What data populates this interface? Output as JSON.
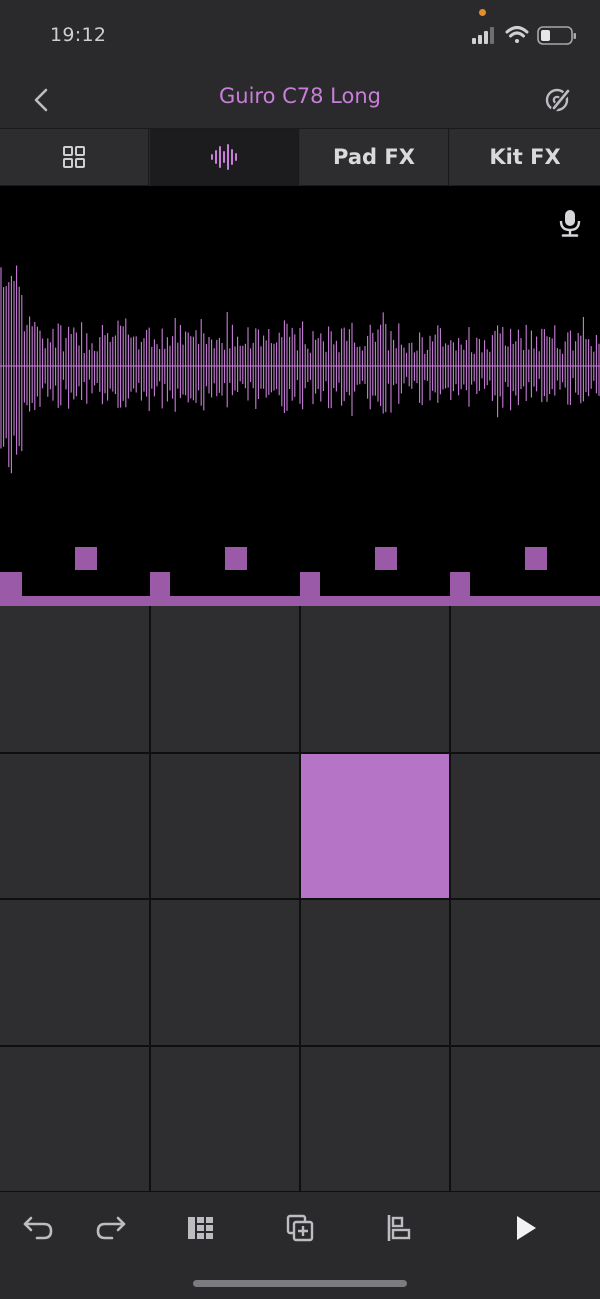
{
  "status": {
    "time": "19:12",
    "icons": [
      "cellular-signal-icon",
      "wifi-icon",
      "battery-icon"
    ]
  },
  "header": {
    "title": "Guiro C78 Long",
    "left_icon": "chevron-left-icon",
    "right_icon": "edit-sound-icon"
  },
  "tabs": [
    {
      "icon": "pads-grid-icon",
      "label": "",
      "active": false
    },
    {
      "icon": "waveform-icon",
      "label": "",
      "active": true
    },
    {
      "icon": "",
      "label": "Pad FX",
      "active": false
    },
    {
      "icon": "",
      "label": "Kit FX",
      "active": false
    }
  ],
  "waveform": {
    "icon": "microphone-icon",
    "color": "#c77fd8"
  },
  "pads": {
    "rows": 4,
    "cols": 4,
    "active_index": 6,
    "active_color": "#b674c7"
  },
  "toolbar": {
    "icons": [
      "undo-icon",
      "redo-icon",
      "sequencer-grid-icon",
      "duplicate-icon",
      "align-icon",
      "play-icon"
    ]
  },
  "colors": {
    "accent": "#c77fd8",
    "background": "#2a292c",
    "pad": "#2e2d30"
  }
}
